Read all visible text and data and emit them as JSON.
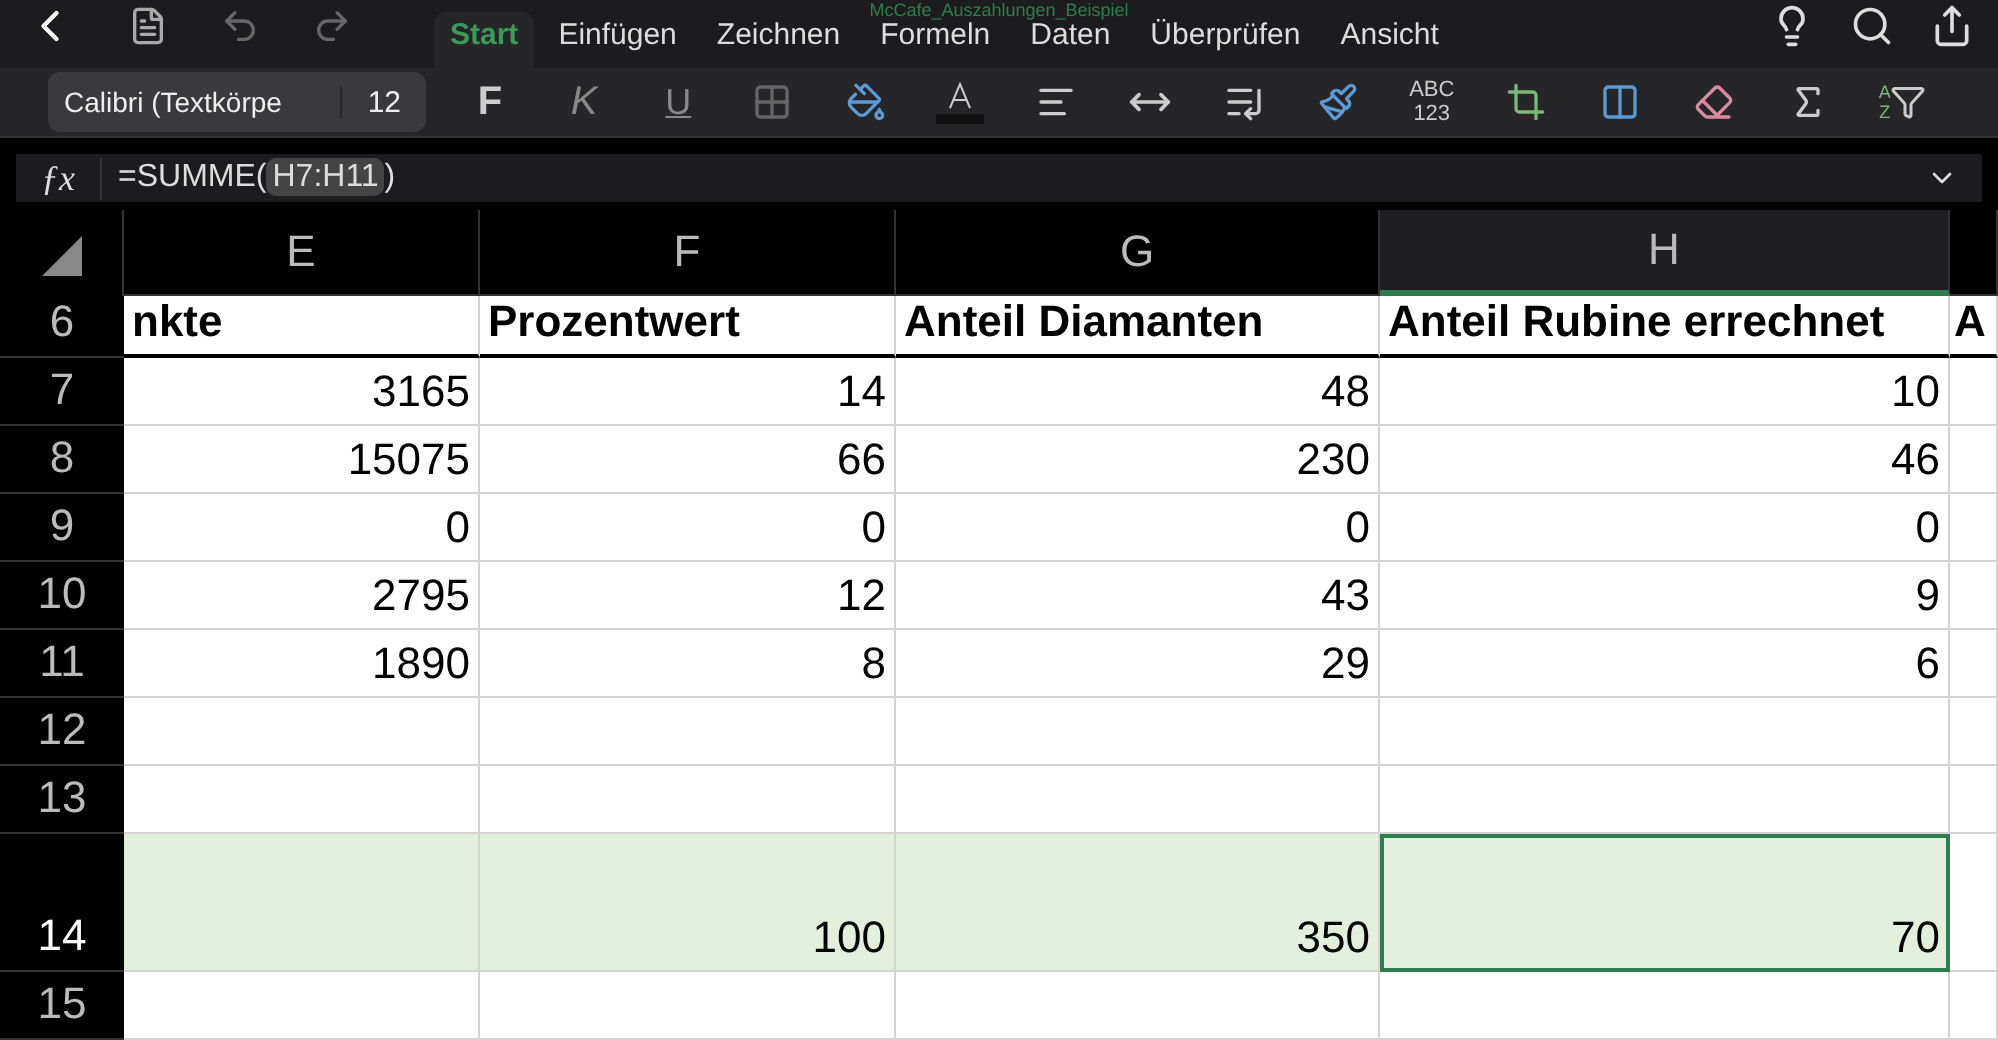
{
  "window": {
    "title": "McCafe_Auszahlungen_Beispiel"
  },
  "tabs": [
    {
      "label": "Start",
      "selected": true
    },
    {
      "label": "Einfügen",
      "selected": false
    },
    {
      "label": "Zeichnen",
      "selected": false
    },
    {
      "label": "Formeln",
      "selected": false
    },
    {
      "label": "Daten",
      "selected": false
    },
    {
      "label": "Überprüfen",
      "selected": false
    },
    {
      "label": "Ansicht",
      "selected": false
    }
  ],
  "ribbon": {
    "font_name": "Calibri (Textkörpe",
    "font_size": "12",
    "bold": "F",
    "italic": "K",
    "underline": "U",
    "number_format": [
      "ABC",
      "123"
    ],
    "sort_letters": [
      "A",
      "Z"
    ]
  },
  "formula_bar": {
    "fx": "ƒx",
    "prefix": "=SUMME(",
    "reference": "H7:H11",
    "suffix": ")"
  },
  "columns": [
    {
      "label": "E",
      "selected": false
    },
    {
      "label": "F",
      "selected": false
    },
    {
      "label": "G",
      "selected": false
    },
    {
      "label": "H",
      "selected": true
    }
  ],
  "rows": [
    {
      "number": "6",
      "kind": "header",
      "cells": [
        "nkte",
        "Prozentwert",
        "Anteil Diamanten",
        "Anteil Rubine errechnet",
        "A"
      ],
      "selected": false
    },
    {
      "number": "7",
      "kind": "data",
      "cells": [
        "3165",
        "14",
        "48",
        "10"
      ],
      "selected": false
    },
    {
      "number": "8",
      "kind": "data",
      "cells": [
        "15075",
        "66",
        "230",
        "46"
      ],
      "selected": false
    },
    {
      "number": "9",
      "kind": "data",
      "cells": [
        "0",
        "0",
        "0",
        "0"
      ],
      "selected": false
    },
    {
      "number": "10",
      "kind": "data",
      "cells": [
        "2795",
        "12",
        "43",
        "9"
      ],
      "selected": false
    },
    {
      "number": "11",
      "kind": "data",
      "cells": [
        "1890",
        "8",
        "29",
        "6"
      ],
      "selected": false
    },
    {
      "number": "12",
      "kind": "data",
      "cells": [],
      "selected": false
    },
    {
      "number": "13",
      "kind": "data",
      "cells": [],
      "selected": false
    },
    {
      "number": "14",
      "kind": "total",
      "cells": [
        "",
        "100",
        "350",
        "70"
      ],
      "selected": true
    },
    {
      "number": "15",
      "kind": "data",
      "cells": [],
      "selected": false
    }
  ]
}
